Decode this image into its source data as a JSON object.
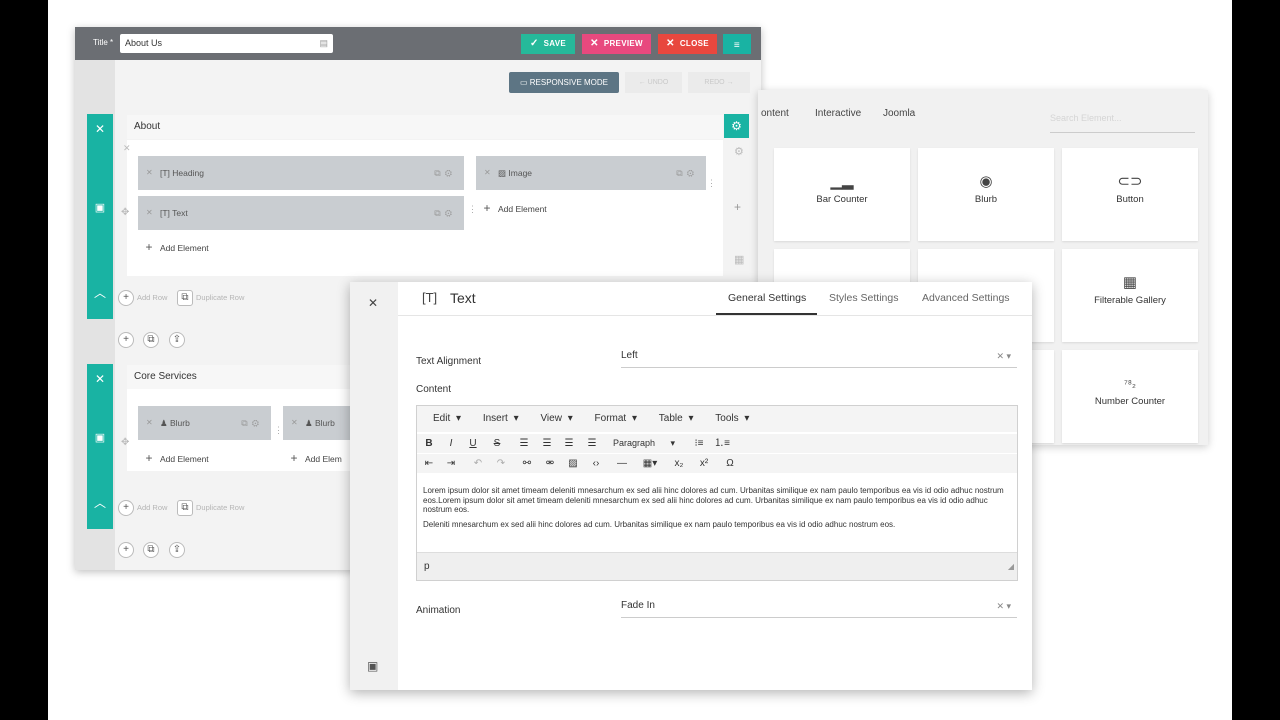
{
  "builder": {
    "title_label": "Title *",
    "title_value": "About Us",
    "save": "SAVE",
    "preview": "PREVIEW",
    "close": "CLOSE",
    "responsive": "RESPONSIVE MODE",
    "undo": "UNDO",
    "redo": "REDO",
    "sections": [
      {
        "name": "About",
        "elements": [
          "Heading",
          "Text",
          "Image"
        ],
        "add_element": "Add Element",
        "add_row": "Add Row",
        "duplicate_row": "Duplicate Row"
      },
      {
        "name": "Core Services",
        "elements": [
          "Blurb",
          "Blurb"
        ],
        "add_element": "Add Element",
        "add_element_cut": "Add Elem",
        "add_row": "Add Row",
        "duplicate_row": "Duplicate Row"
      }
    ]
  },
  "panel": {
    "tabs": [
      "ontent",
      "Interactive",
      "Joomla"
    ],
    "search_placeholder": "Search Element...",
    "cards": [
      "Bar Counter",
      "Blurb",
      "Button",
      "Filterable Gallery",
      "Number Counter"
    ]
  },
  "modal": {
    "title": "Text",
    "tabs": [
      "General Settings",
      "Styles Settings",
      "Advanced Settings"
    ],
    "text_alignment_label": "Text Alignment",
    "text_alignment_value": "Left",
    "content_label": "Content",
    "menu": [
      "Edit",
      "Insert",
      "View",
      "Format",
      "Table",
      "Tools"
    ],
    "paragraph_select": "Paragraph",
    "para1": "Lorem ipsum dolor sit amet timeam deleniti mnesarchum ex sed alii hinc dolores ad cum. Urbanitas similique ex nam paulo temporibus ea vis id odio adhuc nostrum eos.Lorem ipsum dolor sit amet timeam deleniti mnesarchum ex sed alii hinc dolores ad cum. Urbanitas similique ex nam paulo temporibus ea vis id odio adhuc nostrum eos.",
    "para2": "Deleniti mnesarchum ex sed alii hinc dolores ad cum. Urbanitas similique ex nam paulo temporibus ea vis id odio adhuc nostrum eos.",
    "status_path": "p",
    "animation_label": "Animation",
    "animation_value": "Fade In"
  },
  "colors": {
    "teal": "#19b3a3",
    "save": "#26b99a",
    "preview": "#e8497e",
    "close": "#e8473e",
    "topbar": "#6b6e73"
  }
}
